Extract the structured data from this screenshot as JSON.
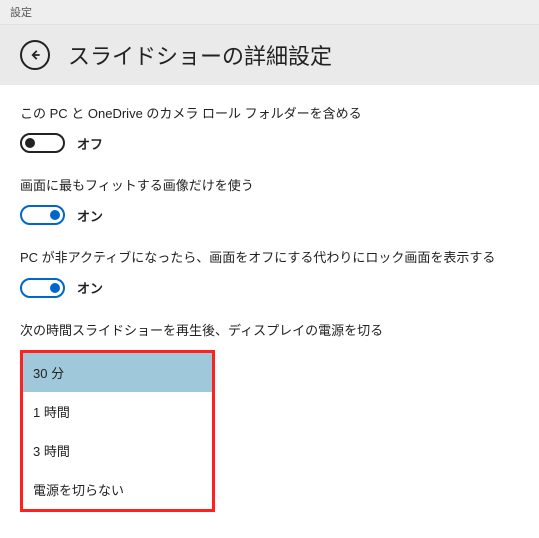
{
  "window": {
    "titlebar": "設定"
  },
  "header": {
    "title": "スライドショーの詳細設定"
  },
  "settings": {
    "include_camera_roll": {
      "label": "この PC と OneDrive のカメラ ロール フォルダーを含める",
      "state_text": "オフ",
      "on": false
    },
    "fit_images": {
      "label": "画面に最もフィットする画像だけを使う",
      "state_text": "オン",
      "on": true
    },
    "lock_screen_inactive": {
      "label": "PC が非アクティブになったら、画面をオフにする代わりにロック画面を表示する",
      "state_text": "オン",
      "on": true
    },
    "display_off": {
      "label": "次の時間スライドショーを再生後、ディスプレイの電源を切る",
      "options": [
        "30 分",
        "1 時間",
        "3 時間",
        "電源を切らない"
      ],
      "selected_index": 0
    }
  }
}
